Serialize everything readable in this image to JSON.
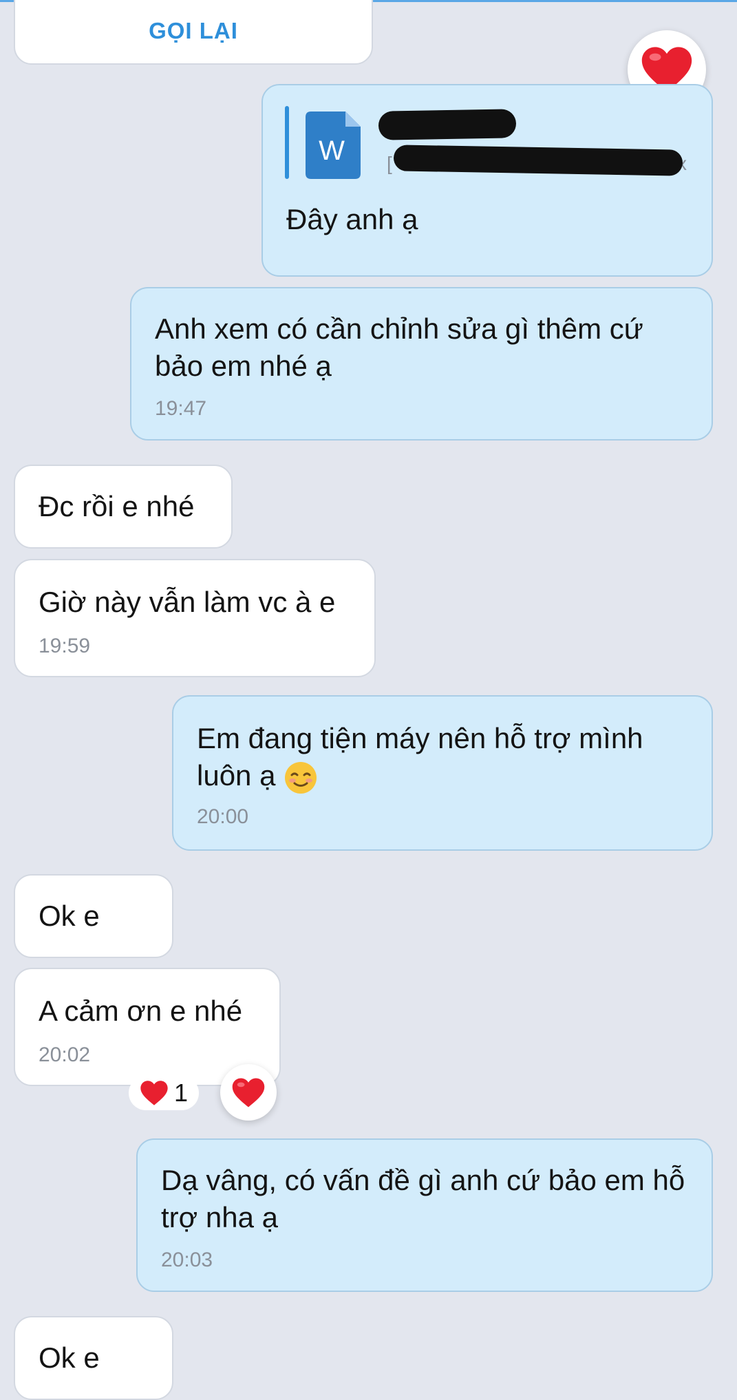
{
  "callback": {
    "label": "GỌI LẠI"
  },
  "file_message": {
    "file_hint_left": "[",
    "file_hint_right": "cx",
    "text": "Đây anh ạ",
    "icon": "word-document-icon"
  },
  "messages": [
    {
      "side": "out",
      "text": "Anh xem có cần chỉnh sửa gì thêm cứ bảo em nhé ạ",
      "time": "19:47"
    },
    {
      "side": "in",
      "text": "Đc rồi e nhé",
      "time": ""
    },
    {
      "side": "in",
      "text": "Giờ này vẫn làm vc à e",
      "time": "19:59"
    },
    {
      "side": "out",
      "text": "Em đang tiện máy nên hỗ trợ mình luôn ạ",
      "emoji": "☺️",
      "time": "20:00"
    },
    {
      "side": "in",
      "text": "Ok e",
      "time": ""
    },
    {
      "side": "in",
      "text": "A cảm ơn e nhé",
      "time": "20:02"
    },
    {
      "side": "out",
      "text": "Dạ vâng, có vấn đề gì anh cứ bảo em hỗ trợ nha ạ",
      "time": "20:03"
    },
    {
      "side": "in",
      "text": "Ok e",
      "time": ""
    }
  ],
  "reaction": {
    "count": "1",
    "icon": "heart-icon"
  },
  "colors": {
    "accent": "#2e8fda",
    "outgoing_bubble": "#d3ecfb",
    "incoming_bubble": "#ffffff",
    "background": "#e3e6ee",
    "heart": "#e8202f"
  }
}
